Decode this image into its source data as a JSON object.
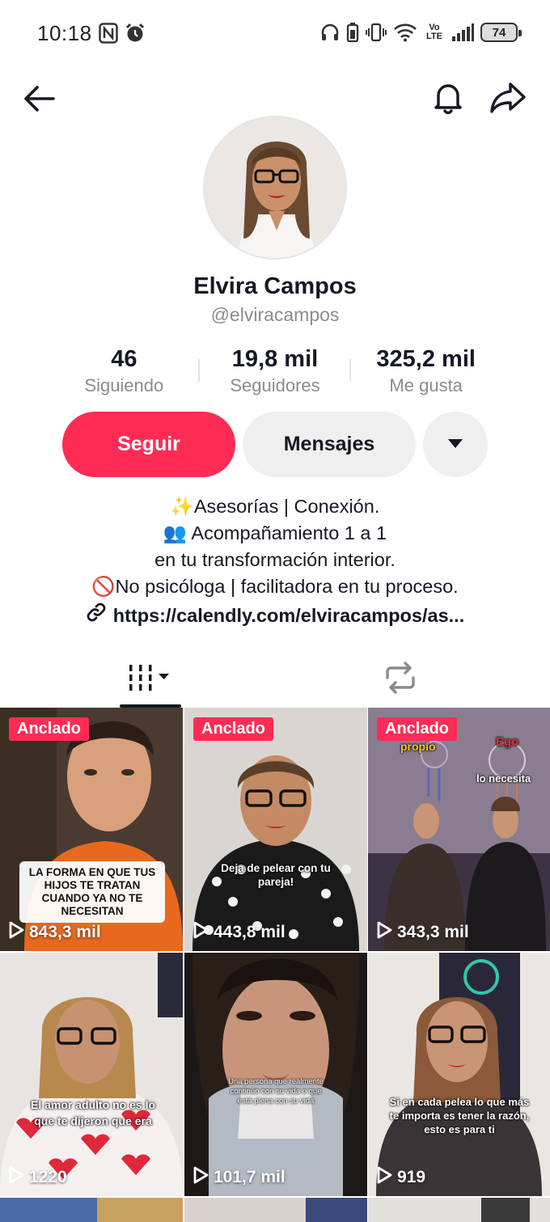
{
  "status": {
    "time": "10:18",
    "volte_top": "Vo",
    "volte_bottom": "LTE",
    "battery": "74"
  },
  "profile": {
    "name": "Elvira Campos",
    "username": "@elviracampos",
    "stats": [
      {
        "value": "46",
        "label": "Siguiendo"
      },
      {
        "value": "19,8 mil",
        "label": "Seguidores"
      },
      {
        "value": "325,2 mil",
        "label": "Me gusta"
      }
    ],
    "follow_label": "Seguir",
    "message_label": "Mensajes",
    "bio": [
      "✨Asesorías | Conexión.",
      "👥 Acompañamiento 1 a 1",
      "en tu transformación interior.",
      "🚫No psicóloga | facilitadora en tu proceso."
    ],
    "link": "https://calendly.com/elviracampos/as..."
  },
  "videos": [
    {
      "pinned": "Anclado",
      "views": "843,3 mil",
      "caption": "LA FORMA EN QUE TUS HIJOS TE TRATAN CUANDO YA NO TE NECESITAN"
    },
    {
      "pinned": "Anclado",
      "views": "443,8 mil",
      "caption": "Deja de pelear con tu pareja!"
    },
    {
      "pinned": "Anclado",
      "views": "343,3 mil",
      "caption_a": "propio",
      "caption_b": "Ego",
      "caption_c": "lo necesita"
    },
    {
      "views": "1220",
      "caption": "El amor adulto no es lo que te dijeron que era"
    },
    {
      "views": "101,7 mil",
      "caption": "Una persona que realmente continúo con su vida o que está plena con su vida"
    },
    {
      "views": "919",
      "caption": "Si en cada pelea lo que más te importa es tener la razón, esto es para ti"
    }
  ],
  "colors": {
    "accent": "#fe2c55",
    "text": "#161823",
    "muted": "#8a8b91"
  }
}
